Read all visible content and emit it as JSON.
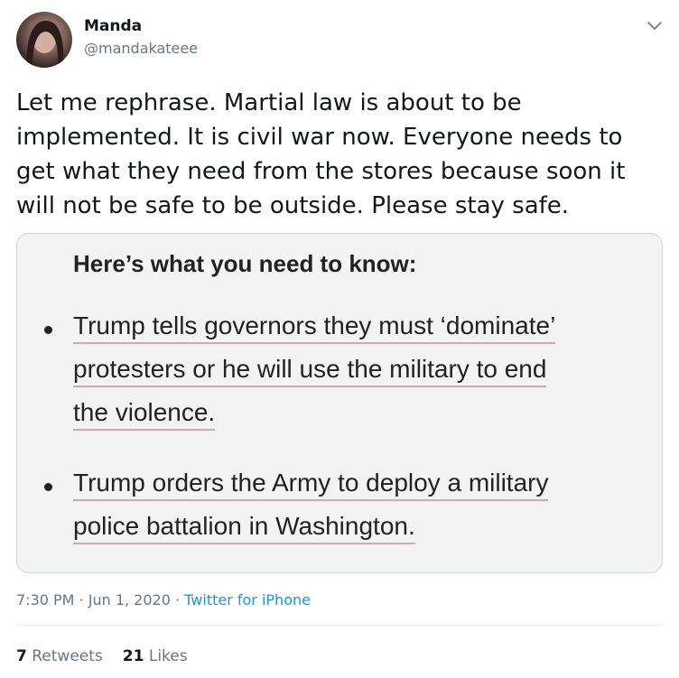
{
  "author": {
    "display_name": "Manda",
    "handle": "@mandakateee"
  },
  "tweet": {
    "text": "Let me rephrase. Martial law is about to be implemented. It is civil war now. Everyone needs to get what they need from the stores because soon it will not be safe to be outside. Please stay safe."
  },
  "media": {
    "heading": "Here’s what you need to know:",
    "bullets": [
      {
        "lines": [
          "Trump tells governors they must ‘dominate’",
          "protesters or he will use the military to end",
          "the violence."
        ]
      },
      {
        "lines": [
          "Trump orders the Army to deploy a military",
          "police battalion in Washington."
        ]
      }
    ]
  },
  "meta": {
    "time": "7:30 PM",
    "separator1": " · ",
    "date": "Jun 1, 2020",
    "separator2": " · ",
    "source": "Twitter for iPhone"
  },
  "stats": {
    "retweets_count": "7",
    "retweets_label": "Retweets",
    "likes_count": "21",
    "likes_label": "Likes"
  },
  "colors": {
    "link": "#1b95e0",
    "secondary_text": "#657786",
    "primary_text": "#14171a",
    "underline_pink": "#d9a5b0"
  },
  "icons": {
    "caret": "chevron-down-icon",
    "avatar": "avatar"
  }
}
